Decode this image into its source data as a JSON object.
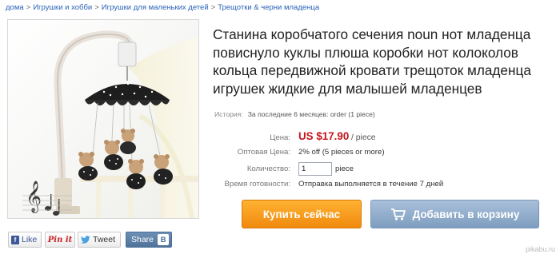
{
  "breadcrumb": {
    "items": [
      "дома",
      "Игрушки и хобби",
      "Игрушки для маленьких детей",
      "Трещотки & черни младенца"
    ],
    "separator": ">"
  },
  "product": {
    "title": "Станина коробчатого сечения noun нот младенца повиснуло куклы плюша коробки нот колоколов кольца передвижной кровати трещоток младенца игрушек жидкие для малышей младенцев"
  },
  "history": {
    "label": "История:",
    "value": "За последние 6 месяцев: order (1 piece)"
  },
  "price": {
    "label": "Цена:",
    "amount": "US $17.90",
    "unit": "/ piece"
  },
  "wholesale": {
    "label": "Оптовая Цена:",
    "value": "2% off (5 pieces or more)"
  },
  "quantity": {
    "label": "Количество:",
    "value": "1",
    "unit": "piece"
  },
  "ready_time": {
    "label": "Время готовности:",
    "value": "Отправка выполняется в течение 7 дней"
  },
  "buttons": {
    "buy": "Купить сейчас",
    "cart": "Добавить в корзину"
  },
  "social": {
    "like": "Like",
    "pin": "Pin it",
    "tweet": "Tweet",
    "share": "Share",
    "vk": "B"
  },
  "watermark": "pikabu.ru",
  "colors": {
    "link": "#2a62b8",
    "price": "#c4161c",
    "buy_button": "#f39519",
    "cart_button": "#8aa6c6"
  }
}
